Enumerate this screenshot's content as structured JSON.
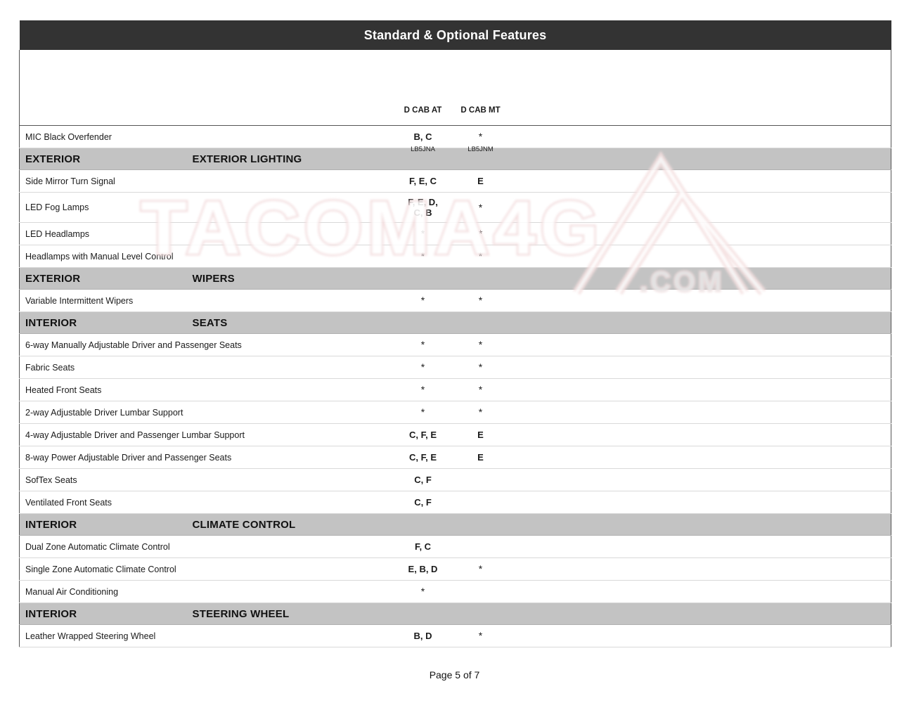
{
  "document": {
    "title": "Standard & Optional Features",
    "footer": "Page 5 of 7",
    "watermark_primary": "TACOMA4G",
    "watermark_secondary": ".COM"
  },
  "colors": {
    "title_bar_bg": "#333333",
    "title_bar_text": "#ffffff",
    "category_bg": "#c3c3c3",
    "row_bg": "#ffffff",
    "text": "#1a1a1a",
    "rule": "#555555",
    "row_rule": "#d9d9d9",
    "watermark": "#f0dede"
  },
  "table": {
    "columns": [
      {
        "key": "feature",
        "label": "",
        "code": ""
      },
      {
        "key": "dcabat",
        "label": "D CAB AT",
        "code": "LB5JNA"
      },
      {
        "key": "dcabmt",
        "label": "D CAB MT",
        "code": "LB5JNM"
      }
    ],
    "rows": [
      {
        "type": "feature",
        "feature": "MIC Black Overfender",
        "dcabat": "B, C",
        "dcabmt": "*"
      },
      {
        "type": "category",
        "group": "EXTERIOR",
        "subgroup": "EXTERIOR LIGHTING"
      },
      {
        "type": "feature",
        "feature": "Side Mirror Turn Signal",
        "dcabat": "F, E, C",
        "dcabmt": "E"
      },
      {
        "type": "feature",
        "tall": true,
        "feature": "LED Fog Lamps",
        "dcabat": "F, E, D,\nC, B",
        "dcabmt": "*"
      },
      {
        "type": "feature",
        "feature": "LED Headlamps",
        "dcabat": "*",
        "dcabmt": "*"
      },
      {
        "type": "feature",
        "feature": "Headlamps with Manual Level Control",
        "dcabat": "*",
        "dcabmt": "*"
      },
      {
        "type": "category",
        "group": "EXTERIOR",
        "subgroup": "WIPERS"
      },
      {
        "type": "feature",
        "feature": "Variable Intermittent Wipers",
        "dcabat": "*",
        "dcabmt": "*"
      },
      {
        "type": "category",
        "group": "INTERIOR",
        "subgroup": "SEATS"
      },
      {
        "type": "feature",
        "feature": "6-way Manually Adjustable Driver and Passenger Seats",
        "dcabat": "*",
        "dcabmt": "*"
      },
      {
        "type": "feature",
        "feature": "Fabric Seats",
        "dcabat": "*",
        "dcabmt": "*"
      },
      {
        "type": "feature",
        "feature": "Heated Front Seats",
        "dcabat": "*",
        "dcabmt": "*"
      },
      {
        "type": "feature",
        "feature": "2-way Adjustable Driver Lumbar Support",
        "dcabat": "*",
        "dcabmt": "*"
      },
      {
        "type": "feature",
        "feature": "4-way Adjustable Driver and Passenger Lumbar Support",
        "dcabat": "C, F, E",
        "dcabmt": "E"
      },
      {
        "type": "feature",
        "feature": "8-way Power Adjustable Driver and Passenger Seats",
        "dcabat": "C, F, E",
        "dcabmt": "E"
      },
      {
        "type": "feature",
        "feature": "SofTex Seats",
        "dcabat": "C, F",
        "dcabmt": ""
      },
      {
        "type": "feature",
        "feature": "Ventilated Front Seats",
        "dcabat": "C, F",
        "dcabmt": ""
      },
      {
        "type": "category",
        "group": "INTERIOR",
        "subgroup": "CLIMATE CONTROL"
      },
      {
        "type": "feature",
        "feature": "Dual Zone Automatic Climate Control",
        "dcabat": "F, C",
        "dcabmt": ""
      },
      {
        "type": "feature",
        "feature": "Single Zone Automatic Climate Control",
        "dcabat": "E, B, D",
        "dcabmt": "*"
      },
      {
        "type": "feature",
        "feature": "Manual Air Conditioning",
        "dcabat": "*",
        "dcabmt": ""
      },
      {
        "type": "category",
        "group": "INTERIOR",
        "subgroup": "STEERING WHEEL"
      },
      {
        "type": "feature",
        "feature": "Leather Wrapped Steering Wheel",
        "dcabat": "B, D",
        "dcabmt": "*"
      }
    ]
  }
}
